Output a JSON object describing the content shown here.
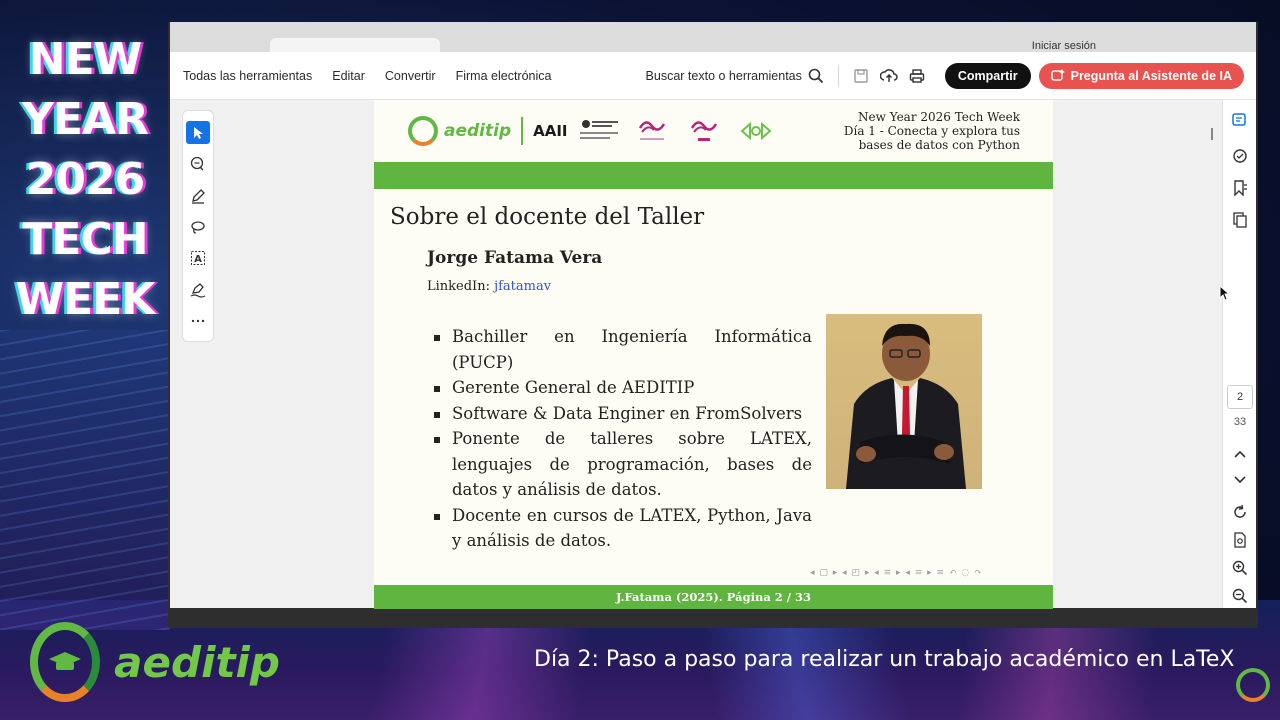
{
  "overlay": {
    "event_title_lines": [
      "NEW",
      "YEAR",
      "2026",
      "TECH",
      "WEEK"
    ],
    "brand_name": "aeditip",
    "footer_title": "Día 2: Paso a paso para realizar un trabajo académico en LaTeX"
  },
  "browser": {
    "tab_title": "",
    "signin_label": "Iniciar sesión"
  },
  "toolbar": {
    "menu": [
      "Todas las herramientas",
      "Editar",
      "Convertir",
      "Firma electrónica"
    ],
    "search_label": "Buscar texto o herramientas",
    "share_label": "Compartir",
    "ai_label": "Pregunta al Asistente de IA"
  },
  "page_nav": {
    "current_page": "2",
    "total_pages": "33"
  },
  "slide": {
    "header_lines": [
      "New Year 2026 Tech Week",
      "Día 1 - Conecta y explora tus",
      "bases de datos con Python"
    ],
    "logo_text": "aeditip",
    "logo_aaii": "AAII",
    "title": "Sobre el docente del Taller",
    "speaker_name": "Jorge Fatama Vera",
    "linkedin_label": "LinkedIn:",
    "linkedin_handle": "jfatamav",
    "bullets": [
      "Bachiller en Ingeniería Informática (PUCP)",
      "Gerente General de AEDITIP",
      "Software & Data Enginer en FromSolvers",
      "Ponente de talleres sobre LATEX, lenguajes de programación, bases de datos y análisis de datos.",
      "Docente en cursos de LATEX, Python, Java y análisis de datos."
    ],
    "footer": "J.Fatama (2025). Página 2 / 33"
  },
  "colors": {
    "slide_green": "#5fb53f",
    "ai_button": "#e8524f",
    "share_button": "#111111",
    "active_tool": "#1473e6",
    "link": "#3a4fd6"
  },
  "icons": {
    "tools": [
      "select-arrow-icon",
      "comment-icon",
      "highlight-pen-icon",
      "lasso-icon",
      "text-select-icon",
      "signature-icon",
      "more-icon"
    ],
    "right_panel": [
      "ai-panel-icon",
      "comment-panel-icon",
      "bookmark-icon",
      "pages-icon",
      "chevron-up-icon",
      "chevron-down-icon",
      "refresh-icon",
      "file-search-icon",
      "zoom-in-icon",
      "zoom-out-icon"
    ]
  }
}
